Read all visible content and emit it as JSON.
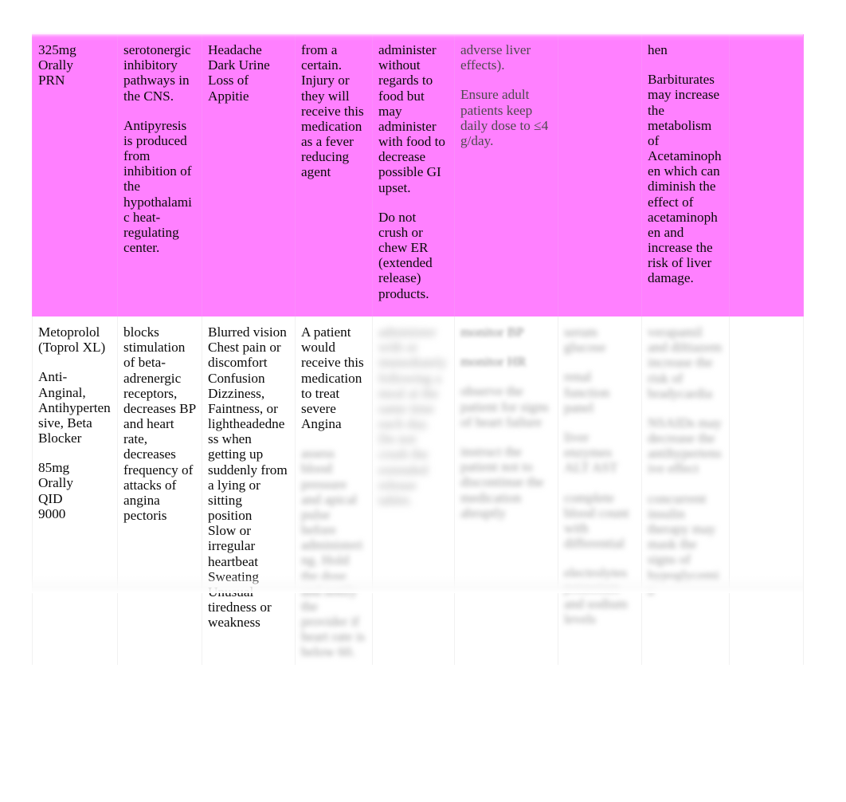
{
  "document": {
    "type": "medication-reference-table",
    "highlight_color": "#ff80ff",
    "page_background": "#ffffff",
    "text_color": "#0a0a0a",
    "muted_text_color": "#4f4a4f"
  },
  "table": {
    "columns": [
      {
        "key": "drug_dose",
        "name": "drug-dose-column"
      },
      {
        "key": "action",
        "name": "action-column"
      },
      {
        "key": "side_effects",
        "name": "side-effects-column"
      },
      {
        "key": "indication",
        "name": "indication-column"
      },
      {
        "key": "administration",
        "name": "administration-column"
      },
      {
        "key": "nursing",
        "name": "nursing-considerations-column"
      },
      {
        "key": "labs",
        "name": "labs-column"
      },
      {
        "key": "interactions",
        "name": "interactions-column"
      },
      {
        "key": "extra",
        "name": "extra-column"
      }
    ],
    "rows": [
      {
        "name": "acetaminophen-row",
        "highlighted": true,
        "drug_dose": {
          "blocks": [
            "325mg\nOrally\nPRN"
          ],
          "blurred": false
        },
        "action": {
          "blocks": [
            "serotonergic inhibitory pathways in the CNS.",
            "Antipyresis is produced from inhibition of the hypothalamic heat-regulating center."
          ],
          "blurred": false
        },
        "side_effects": {
          "blocks": [
            "Headache\nDark Urine\nLoss of Appitie"
          ],
          "blurred": false
        },
        "indication": {
          "blocks": [
            "from a certain. Injury or they will receive this medication as a fever reducing agent"
          ],
          "blurred": false
        },
        "administration": {
          "blocks": [
            "administer without regards to food but may administer with food to decrease possible GI upset.",
            "Do not crush or chew ER (extended release) products."
          ],
          "blurred": false
        },
        "nursing": {
          "blocks": [
            "adverse liver effects).",
            "Ensure adult patients keep daily dose to ≤4 g/day."
          ],
          "muted": true,
          "blurred": false
        },
        "labs": {
          "blocks": [
            ""
          ],
          "blurred": false
        },
        "interactions": {
          "blocks": [
            "hen",
            "Barbiturates may increase the metabolism of Acetaminophen which can diminish the effect of acetaminophen and increase the risk of liver damage."
          ],
          "blurred": false
        },
        "extra": {
          "blocks": [
            ""
          ],
          "blurred": false
        }
      },
      {
        "name": "metoprolol-row",
        "highlighted": false,
        "drug_dose": {
          "blocks": [
            "Metoprolol\n(Toprol XL)",
            "Anti-Anginal, Antihypertensive, Beta Blocker",
            "85mg\nOrally\nQID\n9000"
          ],
          "blurred": false
        },
        "action": {
          "blocks": [
            "blocks stimulation of beta-adrenergic receptors, decreases BP and heart rate, decreases frequency of attacks of angina pectoris"
          ],
          "blurred": false
        },
        "side_effects": {
          "blocks": [
            "Blurred vision\nChest pain or discomfort\nConfusion\nDizziness, Faintness, or lightheadedness when getting up suddenly from a lying or sitting position\nSlow or irregular heartbeat\nSweating\nUnusual tiredness or weakness"
          ],
          "blurred": false
        },
        "indication": {
          "blocks": [
            "A patient would receive this medication to treat severe Angina"
          ],
          "blurred": false,
          "blurred_tail": "assess blood pressure and apical pulse before administering. Hold the dose and notify the provider if heart rate is below 60."
        },
        "administration": {
          "blocks": [
            "administer with or immediately following a meal at the same time each day. Do not crush the extended release tablet."
          ],
          "blurred": true
        },
        "nursing": {
          "blocks": [
            "monitor BP",
            "monitor HR",
            "observe the patient for signs of heart failure",
            "instruct the patient not to discontinue the medication abruptly"
          ],
          "blurred": true
        },
        "labs": {
          "blocks": [
            "serum glucose",
            "renal function panel",
            "liver enzymes ALT AST",
            "complete blood count with differential",
            "electrolytes potassium and sodium levels"
          ],
          "blurred": true
        },
        "interactions": {
          "blocks": [
            "verapamil and diltiazem increase the risk of bradycardia",
            "NSAIDs may decrease the antihypertensive effect",
            "concurrent insulin therapy may mask the signs of hypoglycemia"
          ],
          "blurred": true
        },
        "extra": {
          "blocks": [
            ""
          ],
          "blurred": false
        }
      }
    ]
  }
}
